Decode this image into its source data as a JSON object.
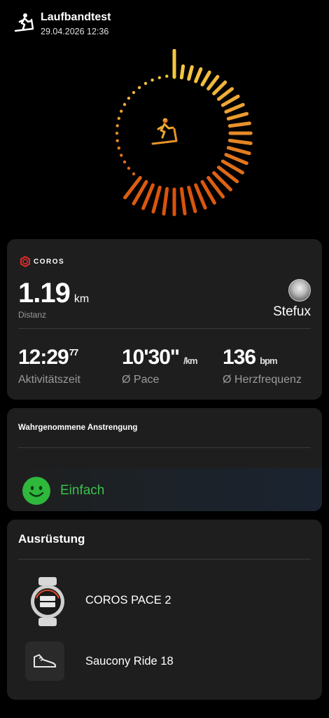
{
  "header": {
    "title": "Laufbandtest",
    "datetime": "29.04.2026 12:36",
    "icon": "treadmill-icon"
  },
  "hero": {
    "icon": "treadmill-icon",
    "colors": {
      "start": "#f5c542",
      "end": "#d9530c"
    }
  },
  "summary": {
    "brand": "COROS",
    "distance": {
      "value": "1.19",
      "unit": "km",
      "label": "Distanz"
    },
    "user": {
      "name": "Stefux"
    },
    "stats": [
      {
        "value": "12:29",
        "sup": "77",
        "unit": "",
        "label": "Aktivitätszeit"
      },
      {
        "value": "10'30\"",
        "sup": "",
        "unit": "/km",
        "label": "Ø Pace"
      },
      {
        "value": "136",
        "sup": "",
        "unit": "bpm",
        "label": "Ø Herzfrequenz"
      }
    ]
  },
  "effort": {
    "title": "Wahrgenommene Anstrengung",
    "value": "Einfach",
    "icon": "smiley-icon",
    "color": "#39c24a"
  },
  "gear": {
    "title": "Ausrüstung",
    "items": [
      {
        "name": "COROS PACE 2",
        "icon": "watch-icon"
      },
      {
        "name": "Saucony Ride 18",
        "icon": "shoe-icon"
      }
    ]
  }
}
